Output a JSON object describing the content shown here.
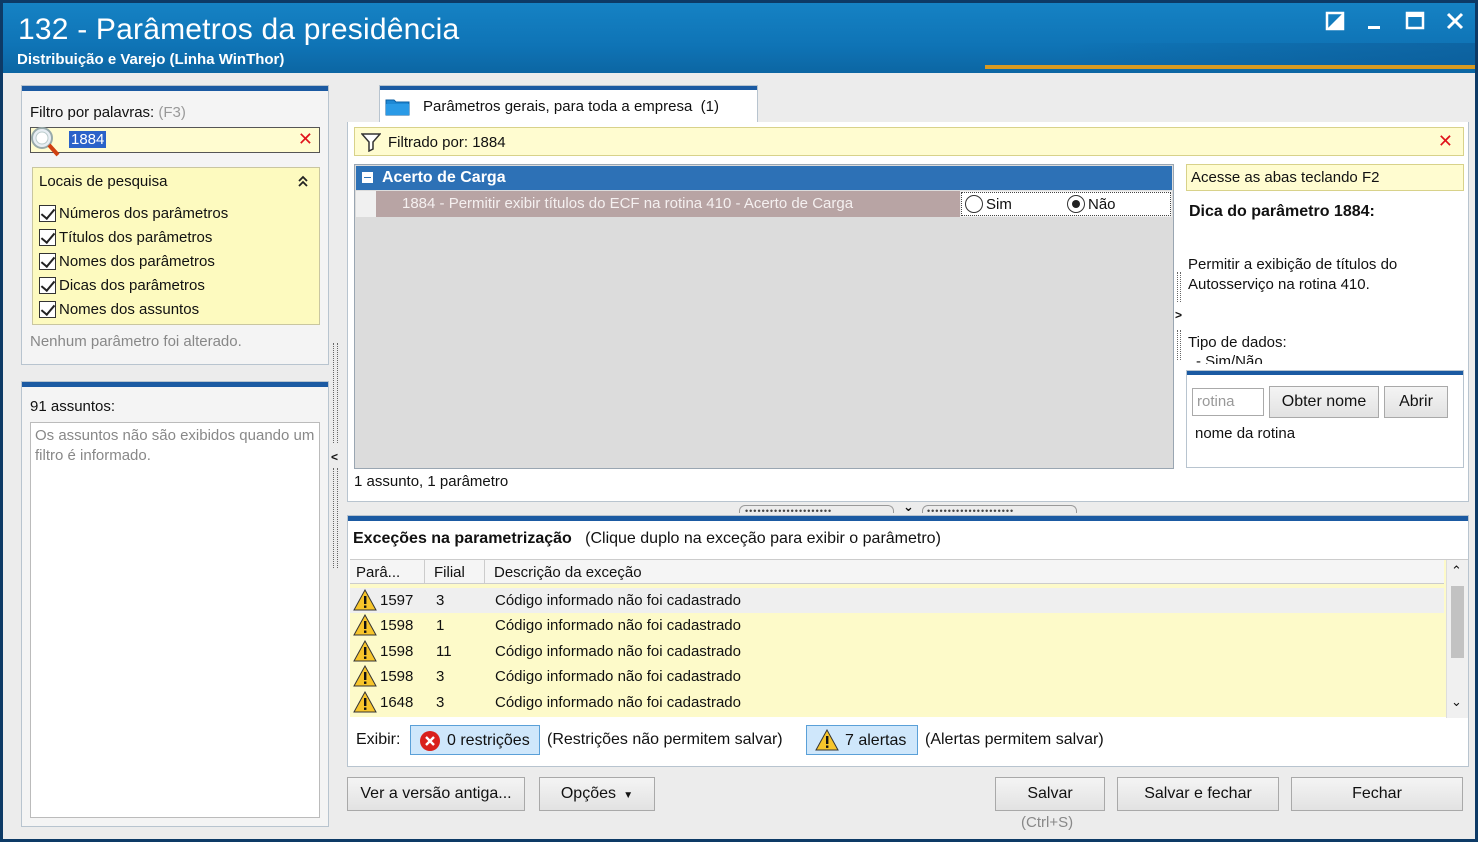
{
  "window": {
    "title": "132 - Parâmetros da presidência",
    "subtitle": "Distribuição e Varejo (Linha WinThor)"
  },
  "filter": {
    "label": "Filtro por palavras:",
    "hint": "(F3)",
    "value": "1884",
    "locais_title": "Locais de pesquisa",
    "options": [
      {
        "label": "Números dos parâmetros",
        "checked": true
      },
      {
        "label": "Títulos dos parâmetros",
        "checked": true
      },
      {
        "label": "Nomes dos parâmetros",
        "checked": true
      },
      {
        "label": "Dicas dos parâmetros",
        "checked": true
      },
      {
        "label": "Nomes dos assuntos",
        "checked": true
      }
    ],
    "status": "Nenhum parâmetro foi alterado."
  },
  "assuntos": {
    "count_label": "91 assuntos:",
    "placeholder_text": "Os assuntos não são exibidos quando um filtro é informado."
  },
  "tab": {
    "label": "Parâmetros gerais, para toda a empresa",
    "count": "(1)"
  },
  "filtered_bar": {
    "text": "Filtrado por: 1884"
  },
  "grid": {
    "group": "Acerto de Carga",
    "row": {
      "description": "1884 - Permitir exibir títulos do ECF na rotina 410 - Acerto de Carga",
      "option_yes": "Sim",
      "option_no": "Não",
      "selected": "Não"
    },
    "summary": "1 assunto, 1 parâmetro"
  },
  "tip": {
    "access_hint": "Acesse as abas teclando F2",
    "title": "Dica do parâmetro 1884:",
    "text": "Permitir a exibição de títulos do Autosserviço na rotina 410.",
    "type_label": "Tipo de dados:",
    "type_value": "- Sim/Não"
  },
  "rotina": {
    "placeholder": "rotina",
    "btn_obter": "Obter nome",
    "btn_abrir": "Abrir",
    "nome_label": "nome da rotina"
  },
  "exceptions": {
    "title": "Exceções na parametrização",
    "hint": "(Clique duplo na exceção para exibir o parâmetro)",
    "columns": [
      "Parâ...",
      "Filial",
      "Descrição da exceção"
    ],
    "rows": [
      {
        "param": "1597",
        "filial": "3",
        "desc": "Código informado não foi cadastrado"
      },
      {
        "param": "1598",
        "filial": "1",
        "desc": "Código informado não foi cadastrado"
      },
      {
        "param": "1598",
        "filial": "11",
        "desc": "Código informado não foi cadastrado"
      },
      {
        "param": "1598",
        "filial": "3",
        "desc": "Código informado não foi cadastrado"
      },
      {
        "param": "1648",
        "filial": "3",
        "desc": "Código informado não foi cadastrado"
      }
    ],
    "exibir_label": "Exibir:",
    "restricoes_btn": "0 restrições",
    "restricoes_note": "(Restrições não permitem salvar)",
    "alertas_btn": "7 alertas",
    "alertas_note": "(Alertas permitem salvar)"
  },
  "footer": {
    "ver_versao": "Ver a versão antiga...",
    "opcoes": "Opções",
    "salvar": "Salvar",
    "salvar_shortcut": "(Ctrl+S)",
    "salvar_fechar": "Salvar e fechar",
    "fechar": "Fechar"
  },
  "colors": {
    "titlebar": "#1582c4",
    "accent_bar": "#1b5aa2",
    "highlight_yellow": "#fffcd0",
    "group_header": "#2d71b6",
    "close_red": "#e0121b"
  }
}
